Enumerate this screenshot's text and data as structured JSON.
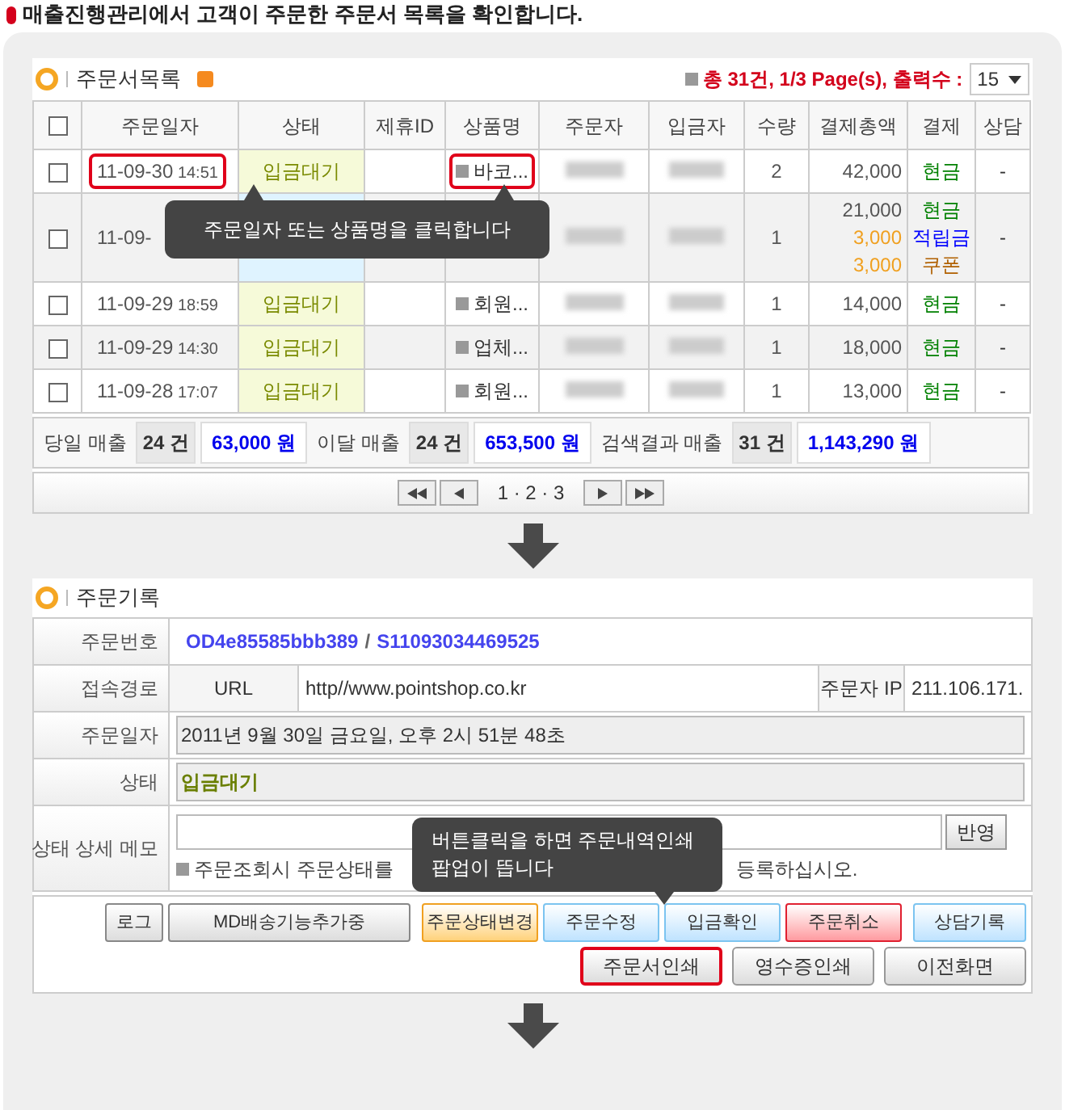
{
  "instruction": "매출진행관리에서 고객이 주문한 주문서 목록을 확인합니다.",
  "order_list": {
    "title": "주문서목록",
    "summary": "총 31건, 1/3 Page(s), 출력수 :",
    "per_page": "15",
    "all_checked": false,
    "columns": [
      "주문일자",
      "상태",
      "제휴ID",
      "상품명",
      "주문자",
      "입금자",
      "수량",
      "결제총액",
      "결제",
      "상담"
    ],
    "rows": [
      {
        "checked": false,
        "date": "11-09-30",
        "time": "14:51",
        "date_highlighted": true,
        "status": "입금대기",
        "kind": "waiting",
        "product": "바코...",
        "product_highlighted": true,
        "qty": "2",
        "amounts": [
          {
            "text": "42,000",
            "color": "#555555"
          }
        ],
        "payments": [
          {
            "text": "현금",
            "color": "#008000"
          }
        ],
        "consult": "-"
      },
      {
        "checked": false,
        "date": "11-09-",
        "date_highlighted": false,
        "kind": "shipping",
        "qty": "1",
        "amounts": [
          {
            "text": "21,000",
            "color": "#555555"
          },
          {
            "text": "3,000",
            "color": "#f0a020"
          },
          {
            "text": "3,000",
            "color": "#f0a020"
          }
        ],
        "payments": [
          {
            "text": "현금",
            "color": "#008000"
          },
          {
            "text": "적립금",
            "color": "#0000ff"
          },
          {
            "text": "쿠폰",
            "color": "#b06000"
          }
        ],
        "consult": "-"
      },
      {
        "checked": false,
        "date": "11-09-29",
        "time": "18:59",
        "date_highlighted": false,
        "status": "입금대기",
        "kind": "waiting",
        "product": "회원...",
        "product_highlighted": false,
        "qty": "1",
        "amounts": [
          {
            "text": "14,000",
            "color": "#555555"
          }
        ],
        "payments": [
          {
            "text": "현금",
            "color": "#008000"
          }
        ],
        "consult": "-"
      },
      {
        "checked": false,
        "date": "11-09-29",
        "time": "14:30",
        "date_highlighted": false,
        "status": "입금대기",
        "kind": "waiting",
        "product": "업체...",
        "product_highlighted": false,
        "qty": "1",
        "amounts": [
          {
            "text": "18,000",
            "color": "#555555"
          }
        ],
        "payments": [
          {
            "text": "현금",
            "color": "#008000"
          }
        ],
        "consult": "-"
      },
      {
        "checked": false,
        "date": "11-09-28",
        "time": "17:07",
        "date_highlighted": false,
        "status": "입금대기",
        "kind": "waiting",
        "product": "회원...",
        "product_highlighted": false,
        "qty": "1",
        "amounts": [
          {
            "text": "13,000",
            "color": "#555555"
          }
        ],
        "payments": [
          {
            "text": "현금",
            "color": "#008000"
          }
        ],
        "consult": "-"
      }
    ],
    "totals": [
      {
        "label": "당일 매출",
        "count": "24 건",
        "amount": "63,000 원"
      },
      {
        "label": "이달 매출",
        "count": "24 건",
        "amount": "653,500 원"
      },
      {
        "label": "검색결과 매출",
        "count": "31 건",
        "amount": "1,143,290 원"
      }
    ],
    "pages": "1 · 2 · 3",
    "callout": "주문일자 또는 상품명을 클릭합니다"
  },
  "order_record": {
    "title": "주문기록",
    "order_no_label": "주문번호",
    "order_no": "OD4e85585bbb389",
    "order_no_sep": "/",
    "order_code": "S11093034469525",
    "route_label": "접속경로",
    "route_type": "URL",
    "route_url": "http//www.pointshop.co.kr",
    "ip_label": "주문자 IP",
    "ip": "211.106.171.",
    "date_label": "주문일자",
    "date": "2011년 9월 30일 금요일, 오후 2시 51분 48초",
    "status_label": "상태",
    "status": "입금대기",
    "memo_label": "상태 상세 메모",
    "memo_button": "반영",
    "memo_help_start": "주문조회시 주문상태를",
    "memo_help_end": "등록하십시오.",
    "buttons_top": [
      {
        "label": "로그",
        "kind": "gray"
      },
      {
        "label": "MD배송기능추가중",
        "kind": "gray"
      },
      {
        "label": "주문상태변경",
        "kind": "orange"
      },
      {
        "label": "주문수정",
        "kind": "blue"
      },
      {
        "label": "입금확인",
        "kind": "blue"
      },
      {
        "label": "주문취소",
        "kind": "red"
      },
      {
        "label": "상담기록",
        "kind": "blue"
      }
    ],
    "buttons_bottom": [
      {
        "label": "주문서인쇄",
        "highlighted": true
      },
      {
        "label": "영수증인쇄",
        "highlighted": false
      },
      {
        "label": "이전화면",
        "highlighted": false
      }
    ],
    "callout_lines": [
      "버튼클릭을 하면 주문내역인쇄",
      "팝업이 뜹니다"
    ]
  }
}
